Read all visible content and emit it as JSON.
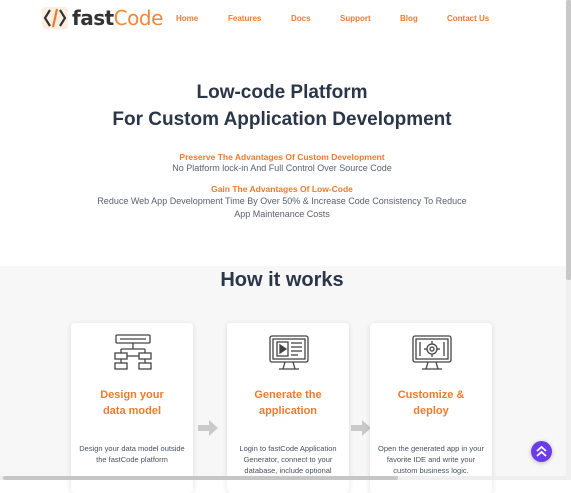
{
  "header": {
    "logo": {
      "part1": "fast",
      "part2": "Code"
    },
    "nav": [
      {
        "label": "Home"
      },
      {
        "label": "Features"
      },
      {
        "label": "Docs"
      },
      {
        "label": "Support"
      },
      {
        "label": "Blog"
      },
      {
        "label": "Contact Us"
      }
    ]
  },
  "hero": {
    "title_line1": "Low-code Platform",
    "title_line2": "For Custom Application Development",
    "block1": {
      "heading": "Preserve The Advantages Of Custom Development",
      "text": "No Platform lock-in And Full Control Over Source Code"
    },
    "block2": {
      "heading": "Gain The Advantages Of Low-Code",
      "text_line1": "Reduce Web App Development Time By Over 50% & Increase Code Consistency To Reduce",
      "text_line2": "App Maintenance Costs"
    }
  },
  "how": {
    "title": "How it works",
    "cards": [
      {
        "title_line1": "Design your",
        "title_line2": "data model",
        "text": "Design your data model outside the fastCode platform",
        "icon": "data-model-icon"
      },
      {
        "title_line1": "Generate the",
        "title_line2": "application",
        "text": "Login to fastCode Application Generator, connect to your database, include optional",
        "icon": "monitor-icon"
      },
      {
        "title_line1": "Customize &",
        "title_line2": "deploy",
        "text": "Open the generated app in your favorite IDE and write your custom business logic.",
        "icon": "gear-tools-icon"
      }
    ]
  },
  "colors": {
    "accent": "#f07a2c",
    "heading": "#2b3648",
    "scroll_button": "#6a3de8"
  }
}
